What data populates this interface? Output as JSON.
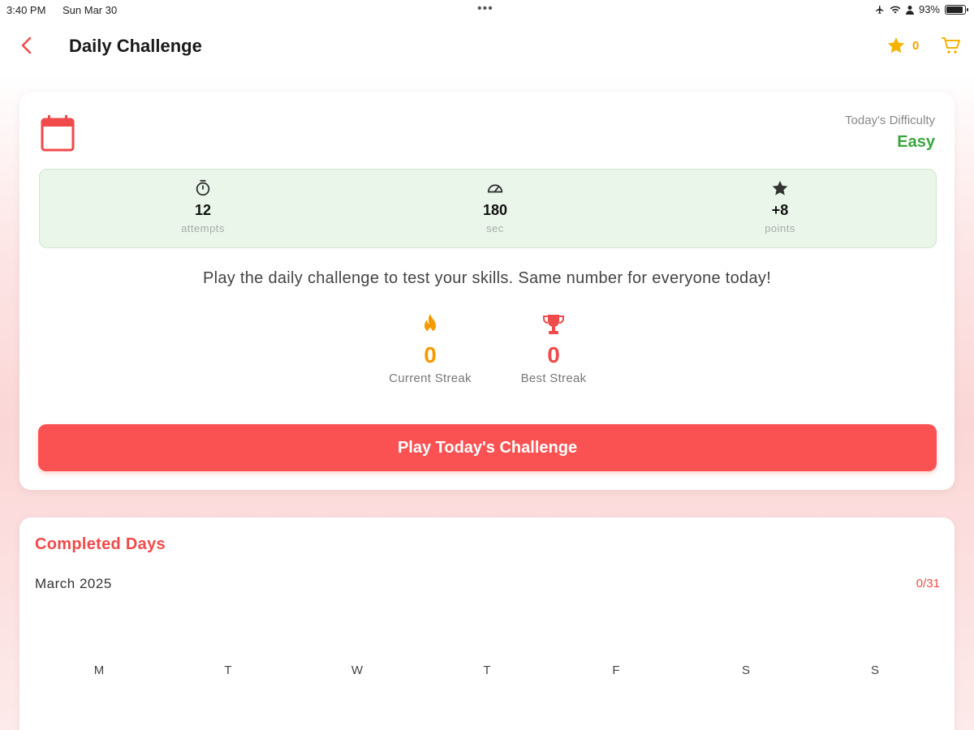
{
  "status_bar": {
    "time": "3:40 PM",
    "date": "Sun Mar 30",
    "dots": "•••",
    "battery": "93%",
    "battery_level": 0.93
  },
  "header": {
    "title": "Daily Challenge",
    "points": "0",
    "accent_color": "#f04a4a"
  },
  "challenge": {
    "difficulty_label": "Today's Difficulty",
    "difficulty_value": "Easy",
    "stats": [
      {
        "icon": "stopwatch-icon",
        "value": "12",
        "unit": "attempts"
      },
      {
        "icon": "speedometer-icon",
        "value": "180",
        "unit": "sec"
      },
      {
        "icon": "star-icon",
        "value": "+8",
        "unit": "points"
      }
    ],
    "description": "Play the daily challenge to test your skills. Same number for everyone today!",
    "current_streak": {
      "value": "0",
      "label": "Current Streak",
      "icon": "flame-icon",
      "color": "#f59a00"
    },
    "best_streak": {
      "value": "0",
      "label": "Best Streak",
      "icon": "trophy-icon",
      "color": "#f04a4a"
    },
    "play_button": "Play Today's Challenge"
  },
  "completed": {
    "title": "Completed Days",
    "month": "March 2025",
    "count": "0/31",
    "weekdays": [
      "M",
      "T",
      "W",
      "T",
      "F",
      "S",
      "S"
    ]
  }
}
